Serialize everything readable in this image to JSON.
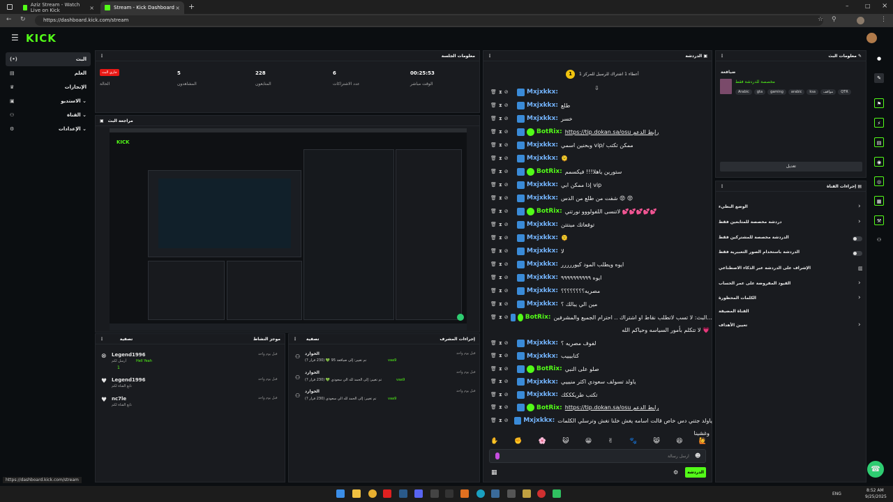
{
  "browser": {
    "tabs": [
      {
        "title": "Aziz Stream - Watch Live on Kick",
        "close": "×"
      },
      {
        "title": "Stream - Kick Dashboard",
        "close": "×"
      }
    ],
    "new_tab": "+",
    "url": "https://dashboard.kick.com/stream",
    "status_url": "https://dashboard.kick.com/stream"
  },
  "logo": "KICK",
  "sidebar": {
    "items": [
      {
        "label": "البث",
        "icon": "(•)"
      },
      {
        "label": "العلم",
        "icon": "▤"
      },
      {
        "label": "الإنجازات",
        "icon": "♛"
      },
      {
        "label": "الاستديو",
        "icon": "▣"
      },
      {
        "label": "القناة",
        "icon": "⚇"
      },
      {
        "label": "الإعدادات",
        "icon": "⚙"
      }
    ]
  },
  "session": {
    "title": "معلومات الجلسة",
    "live_badge": "جاري البث",
    "stats": [
      {
        "value": "",
        "label": "الحالة"
      },
      {
        "value": "5",
        "label": "المشاهدون"
      },
      {
        "value": "228",
        "label": "المتابعون"
      },
      {
        "value": "6",
        "label": "عدد الاشتراكات"
      },
      {
        "value": "00:25:53",
        "label": "الوقت مباشر"
      }
    ]
  },
  "preview": {
    "title": "مراجعة البث"
  },
  "activity": {
    "title": "موجز النشاط",
    "filter": "تصفية",
    "items": [
      {
        "name": "Legend1996",
        "desc": "أرسل لكم",
        "extra": "Hell Yeah",
        "count": "1",
        "time": "قبل يوم واحد"
      },
      {
        "name": "Legend1996",
        "desc": "تابع القناة لكم",
        "time": "قبل يوم واحد"
      },
      {
        "name": "nc7le",
        "desc": "تابع القناة لكم",
        "time": "قبل يوم واحد"
      }
    ]
  },
  "mod_actions": {
    "title": "إجراءات المشرف",
    "filter": "تصفية",
    "items": [
      {
        "name": "الخوارد",
        "desc": "تم تغيير: إلى ضيافعة 95 💚 (230 قرار ?)",
        "user": "vaa9",
        "time": "قبل يوم واحد"
      },
      {
        "name": "الخوارد",
        "desc": "تم تغيير: إلى الحمد لله الي سعودي 💚 (230 قرار ?)",
        "user": "vaa9",
        "time": "قبل يوم واحد"
      },
      {
        "name": "الخوارد",
        "desc": "تم تغيير: إلى الحمد لله الي سعودي (230 قرار ?)",
        "user": "vaa9",
        "time": "قبل يوم واحد"
      }
    ]
  },
  "chat": {
    "title": "الدردشة",
    "pinned_count": "1",
    "pinned_text": "أعطاء 1 اشتراك للرسيل للمركز 1",
    "messages": [
      {
        "user": "Mxjxkkx:",
        "text": "",
        "bot": false
      },
      {
        "user": "Mxjxkkx:",
        "text": "طلع",
        "bot": false
      },
      {
        "user": "Mxjxkkx:",
        "text": "خسر",
        "bot": false
      },
      {
        "user": "BotRix:",
        "text": "https://tip.dokan.sa/osu رابط الدعم",
        "bot": true,
        "link": true
      },
      {
        "user": "Mxjxkkx:",
        "text": "وبحنين اسمي vip/ ممكن تكتب",
        "bot": false
      },
      {
        "user": "Mxjxkkx:",
        "text": "🫠",
        "bot": false
      },
      {
        "user": "BotRix:",
        "text": "ستورين ياهلا!!! فيكسمم",
        "bot": true
      },
      {
        "user": "Mxjxkkx:",
        "text": "إذا ممكن ابي vip",
        "bot": false
      },
      {
        "user": "Mxjxkkx:",
        "text": "شفت من طلع من الدس 😡 😡",
        "bot": false
      },
      {
        "user": "BotRix:",
        "text": "لاتنسى اللفولووو نورتني 💕💕💕💕💕",
        "bot": true
      },
      {
        "user": "Mxjxkkx:",
        "text": "توقعاتك مينتتن",
        "bot": false
      },
      {
        "user": "Mxjxkkx:",
        "text": "🫠",
        "bot": false
      },
      {
        "user": "Mxjxkkx:",
        "text": "لا",
        "bot": false
      },
      {
        "user": "Mxjxkkx:",
        "text": "ايوه ويطلب المود كيوررررر",
        "bot": false
      },
      {
        "user": "Mxjxkkx:",
        "text": "ايوه ٩٩٩٩٩٩٩٩٩٩",
        "bot": false
      },
      {
        "user": "Mxjxkkx:",
        "text": "مصريه؟؟؟؟؟؟؟؟",
        "bot": false
      },
      {
        "user": "Mxjxkkx:",
        "text": "مين الي يبالك ؟",
        "bot": false
      },
      {
        "user": "BotRix:",
        "text": "البث: لا تسب لاتطلب نقاط او اشتراك .. احترام الجميع والمشرفين...",
        "bot": true
      },
      {
        "user": "",
        "text": "لا تتكلم بأمور السياسه وحياكم الله 💗",
        "bot": false,
        "continuation": true
      },
      {
        "user": "Mxjxkkx:",
        "text": "لفوف مصريه ؟",
        "bot": false
      },
      {
        "user": "Mxjxkkx:",
        "text": "كتابيييب",
        "bot": false
      },
      {
        "user": "BotRix:",
        "text": "صلو على النبي",
        "bot": true
      },
      {
        "user": "Mxjxkkx:",
        "text": "ياولد تسولف سعودي اكثر منيييي",
        "bot": false
      },
      {
        "user": "Mxjxkkx:",
        "text": "تكتب طريكككك",
        "bot": false
      },
      {
        "user": "BotRix:",
        "text": "https://tip.dokan.sa/osu رابط الدعم",
        "bot": true,
        "link": true
      },
      {
        "user": "Mxjxkkx:",
        "text": "ياولد جتني دس خاص قالت اسامه يغش خلنا نغش وترسلي الكلمات",
        "bot": false
      },
      {
        "user": "",
        "text": "وغشينا",
        "bot": false,
        "continuation": true
      }
    ],
    "input_placeholder": "ارسل رسالة",
    "send_label": "الدردشة"
  },
  "stream_info": {
    "title": "معلومات البث",
    "stream_title": "ضيافعة",
    "category": "مخصصة للدردشة فقط",
    "tags": [
      "Arabic",
      "gta",
      "gaming",
      "arabic",
      "ksa",
      "مواقف",
      "QTR"
    ],
    "edit_label": "تعديل"
  },
  "channel_actions": {
    "title": "إجراءات القناة",
    "rows": [
      {
        "label": "الوضع البطيء",
        "control": "chevron"
      },
      {
        "label": "دردشة مخصصة للمتابعين فقط",
        "control": "chevron"
      },
      {
        "label": "الدردشة مخصصة للمشتركين فقط",
        "control": "toggle"
      },
      {
        "label": "الدردشة باستخدام الصور التعبيرية فقط",
        "control": "toggle"
      },
      {
        "label": "الإشراف على الدردشة عبر الذكاء الاصطناعي",
        "control": "chart"
      },
      {
        "label": "القيود المفروضة على عمر الحساب",
        "control": "chevron"
      },
      {
        "label": "الكلمات المحظورة",
        "control": "chevron"
      },
      {
        "label": "القناة المضيفة",
        "control": "none"
      },
      {
        "label": "تعيين الأهداف",
        "control": "chevron"
      }
    ]
  },
  "taskbar": {
    "lang": "ENG",
    "time": "8:52 AM",
    "date": "9/25/2025"
  },
  "colors": {
    "brand": "#53fc18",
    "live": "#e91916",
    "chat_user": "#75b6ff"
  }
}
